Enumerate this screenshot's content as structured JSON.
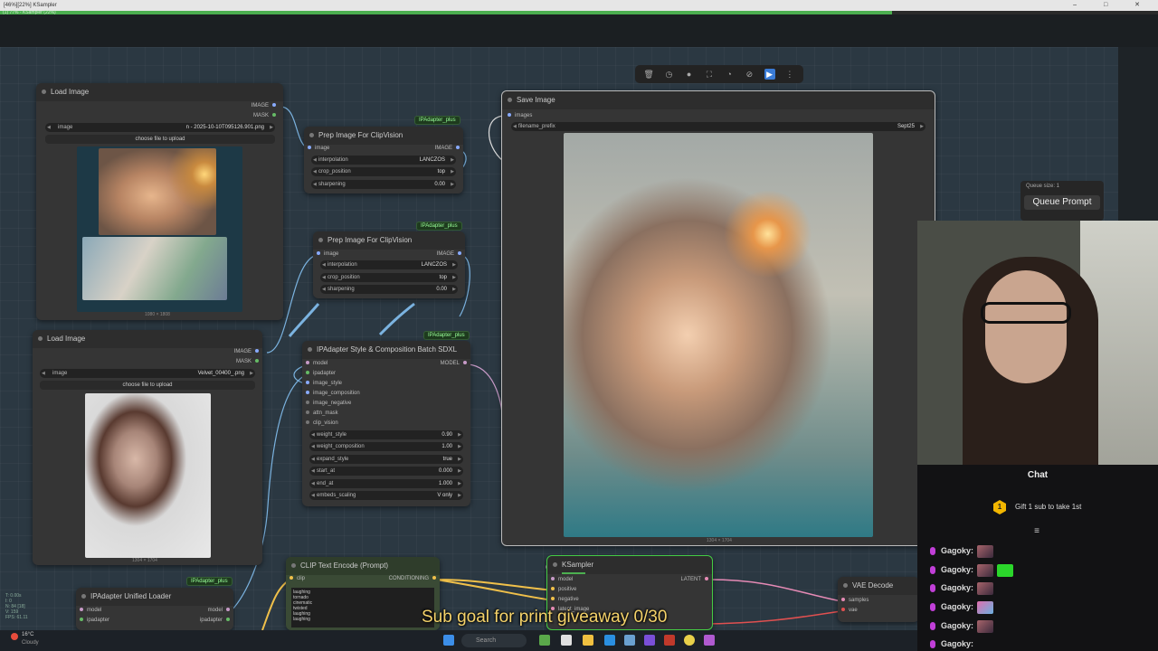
{
  "window": {
    "title": "[46%][22%] KSampler",
    "controls": [
      "–",
      "□",
      "✕"
    ]
  },
  "progress": {
    "label": "(1) 77% - KSampler (22%)",
    "value_percent": 77
  },
  "toolbar": {
    "icons": [
      "trash-icon",
      "clock-icon",
      "dot-icon",
      "fit-icon",
      "mask-icon",
      "hide-icon",
      "play-icon",
      "more-icon"
    ]
  },
  "nodes": {
    "load_image_1": {
      "title": "Load Image",
      "out_image": "IMAGE",
      "out_mask": "MASK",
      "widget_label": "image",
      "widget_value": "n - 2025-10-10T095126.901.png",
      "upload": "choose file to upload",
      "size": "1080 × 1808"
    },
    "load_image_2": {
      "title": "Load Image",
      "out_image": "IMAGE",
      "out_mask": "MASK",
      "widget_label": "image",
      "widget_value": "Velvet_00400_.png",
      "upload": "choose file to upload",
      "size": "1304 × 1704"
    },
    "prep_1": {
      "badge": "IPAdapter_plus",
      "title": "Prep Image For ClipVision",
      "in_image": "image",
      "out_image": "IMAGE",
      "widgets": [
        {
          "label": "interpolation",
          "value": "LANCZOS"
        },
        {
          "label": "crop_position",
          "value": "top"
        },
        {
          "label": "sharpening",
          "value": "0.00"
        }
      ]
    },
    "prep_2": {
      "badge": "IPAdapter_plus",
      "title": "Prep Image For ClipVision",
      "in_image": "image",
      "out_image": "IMAGE",
      "widgets": [
        {
          "label": "interpolation",
          "value": "LANCZOS"
        },
        {
          "label": "crop_position",
          "value": "top"
        },
        {
          "label": "sharpening",
          "value": "0.00"
        }
      ]
    },
    "ipadapter_style": {
      "badge": "IPAdapter_plus",
      "title": "IPAdapter Style & Composition Batch SDXL",
      "inputs": [
        "model",
        "ipadapter",
        "image_style",
        "image_composition",
        "image_negative",
        "attn_mask",
        "clip_vision"
      ],
      "out": "MODEL",
      "widgets": [
        {
          "label": "weight_style",
          "value": "0.90"
        },
        {
          "label": "weight_composition",
          "value": "1.00"
        },
        {
          "label": "expand_style",
          "value": "true"
        },
        {
          "label": "start_at",
          "value": "0.000"
        },
        {
          "label": "end_at",
          "value": "1.000"
        },
        {
          "label": "embeds_scaling",
          "value": "V only"
        }
      ]
    },
    "save_image": {
      "title": "Save Image",
      "in": "images",
      "widget_label": "filename_prefix",
      "widget_value": "Sept25",
      "size": "1304 × 1704"
    },
    "clip_text": {
      "title": "CLIP Text Encode (Prompt)",
      "in": "clip",
      "out": "CONDITIONING",
      "text": "laughing\ntornado\ncinematic\ntwisted\nlaughing\nlaughing"
    },
    "ksampler": {
      "title": "KSampler",
      "inputs": [
        "model",
        "positive",
        "negative",
        "latent_image"
      ],
      "out": "LATENT"
    },
    "vae_decode": {
      "title": "VAE Decode",
      "inputs": [
        "samples",
        "vae"
      ]
    },
    "ipadapter_unified": {
      "badge": "IPAdapter_plus",
      "title": "IPAdapter Unified Loader",
      "inputs": [
        "model",
        "ipadapter"
      ],
      "outputs": [
        "model",
        "ipadapter"
      ]
    }
  },
  "queue": {
    "size_label": "Queue size: 1",
    "button": "Queue Prompt"
  },
  "chat": {
    "title": "Chat",
    "gift_badge": "1",
    "gift_text": "Gift 1 sub to take 1st",
    "messages": [
      {
        "user": "Gagoky:"
      },
      {
        "user": "Gagoky:"
      },
      {
        "user": "Gagoky:"
      },
      {
        "user": "Gagoky:"
      },
      {
        "user": "Gagoky:"
      },
      {
        "user": "Gagoky:"
      }
    ]
  },
  "overlay": {
    "subtitle": "Sub goal for print giveaway 0/30"
  },
  "taskbar": {
    "search_placeholder": "Search",
    "weather_temp": "16°C",
    "weather_label": "Cloudy"
  },
  "side_info": "T: 0.00s\nI: 0\nN: 84 [18]\nV: 159\nFPS: 61.11"
}
